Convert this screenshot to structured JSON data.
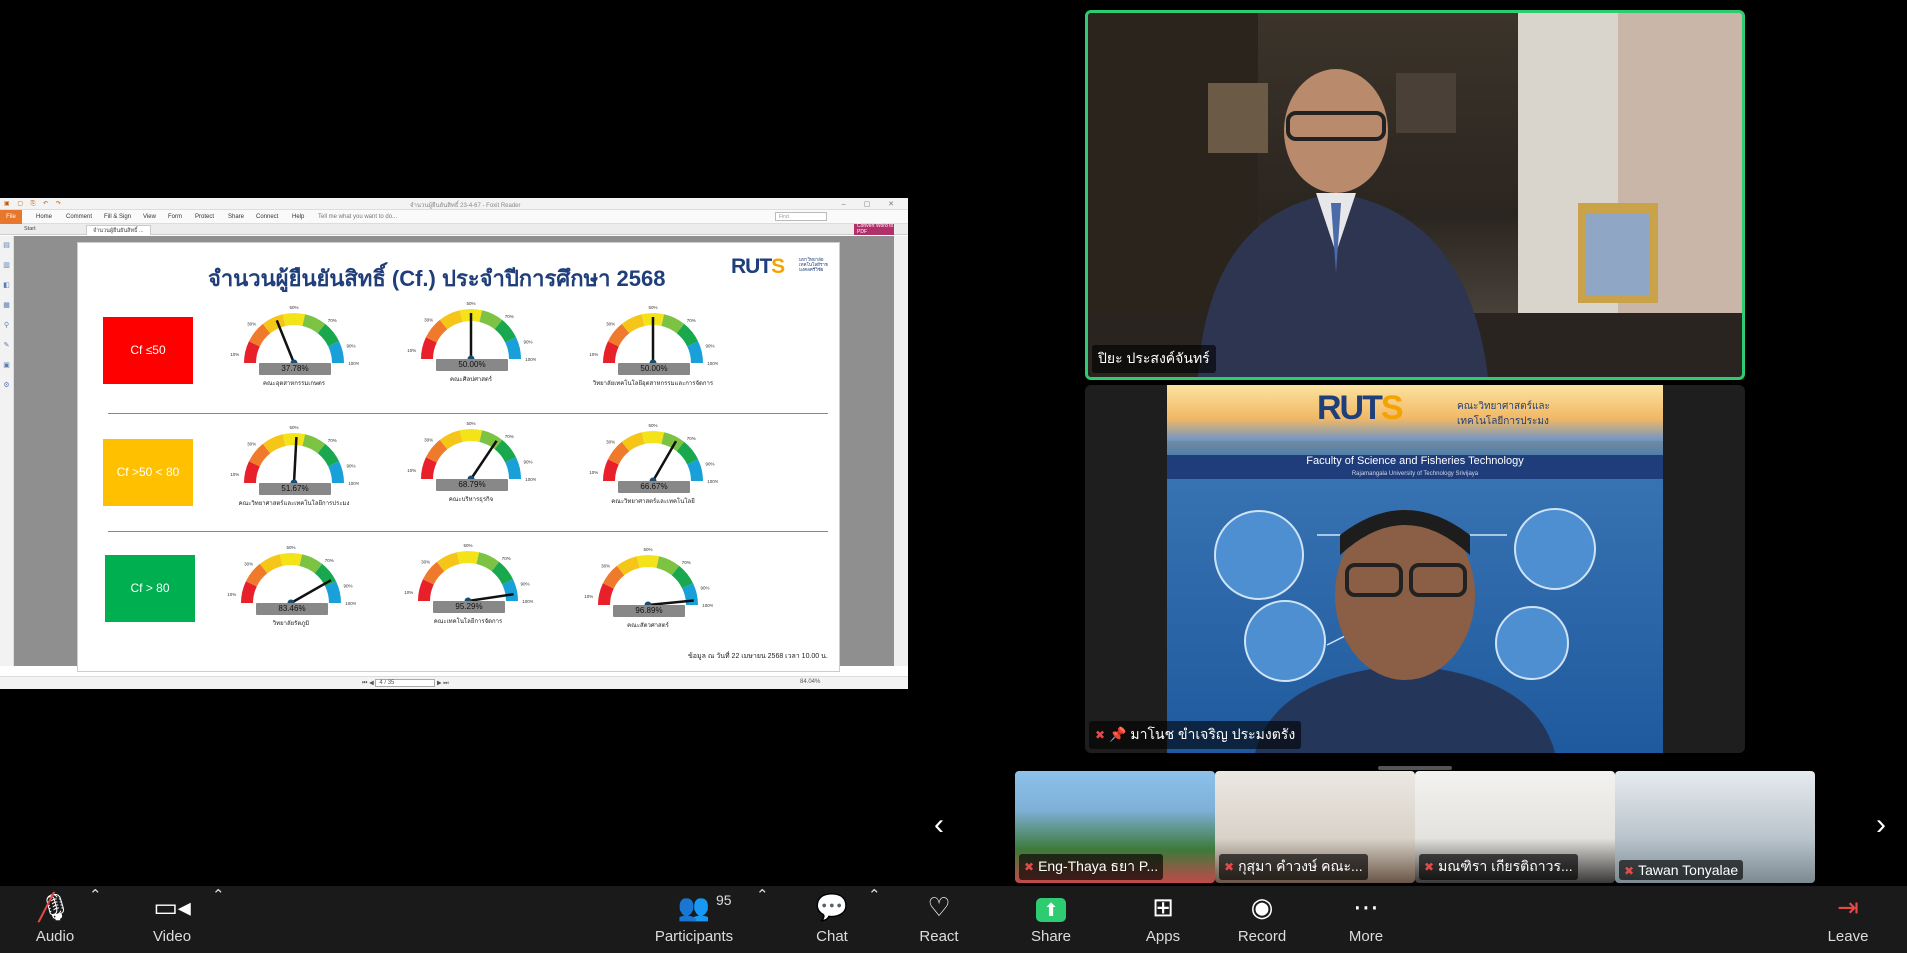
{
  "shared_screen": {
    "window_title": "จำนวนผู้ยืนยันสิทธิ์ 23-4-67 - Foxit Reader",
    "ribbon_file": "File",
    "ribbon_menu": [
      "Home",
      "Comment",
      "Fill & Sign",
      "View",
      "Form",
      "Protect",
      "Share",
      "Connect",
      "Help"
    ],
    "tell_me": "Tell me what you want to do...",
    "search_placeholder": "Find",
    "tabs": [
      "Start",
      "จำนวนผู้ยืนยันสิทธิ์ ..."
    ],
    "convert_label": "Convert Word to PDF",
    "page_indicator": "4 / 35",
    "zoom": "84.04%",
    "slide": {
      "title": "จำนวนผู้ยืนยันสิทธิ์ (Cf.) ประจำปีการศึกษา 2568",
      "logo_text": "RUTS",
      "logo_sub": "มหาวิทยาลัยเทคโนโลยีราชมงคลศรีวิชัย",
      "categories": [
        {
          "label": "Cf ≤50",
          "color": "#ff0000"
        },
        {
          "label": "Cf >50 < 80",
          "color": "#ffc000"
        },
        {
          "label": "Cf > 80",
          "color": "#00b050"
        }
      ],
      "gauge_ticks": [
        "10%",
        "30%",
        "50%",
        "70%",
        "90%",
        "100%"
      ],
      "gauges": [
        {
          "value": "37.78%",
          "fraction": 0.3778,
          "label": "คณะอุตสาหกรรมเกษตร"
        },
        {
          "value": "50.00%",
          "fraction": 0.5,
          "label": "คณะศิลปศาสตร์"
        },
        {
          "value": "50.00%",
          "fraction": 0.5,
          "label": "วิทยาลัยเทคโนโลยีอุตสาหกรรมและการจัดการ"
        },
        {
          "value": "51.67%",
          "fraction": 0.5167,
          "label": "คณะวิทยาศาสตร์และเทคโนโลยีการประมง"
        },
        {
          "value": "68.79%",
          "fraction": 0.6879,
          "label": "คณะบริหารธุรกิจ"
        },
        {
          "value": "66.67%",
          "fraction": 0.6667,
          "label": "คณะวิทยาศาสตร์และเทคโนโลยี"
        },
        {
          "value": "83.46%",
          "fraction": 0.8346,
          "label": "วิทยาลัยรัตภูมิ"
        },
        {
          "value": "95.29%",
          "fraction": 0.9529,
          "label": "คณะเทคโนโลยีการจัดการ"
        },
        {
          "value": "96.89%",
          "fraction": 0.9689,
          "label": "คณะสัตวศาสตร์"
        }
      ],
      "note": "ข้อมูล ณ วันที่ 22 เมษายน 2568 เวลา 10.00 น."
    }
  },
  "active_speaker": {
    "name": "ปิยะ ประสงค์จันทร์"
  },
  "second_speaker": {
    "name": "มาโนช ขำเจริญ ประมงตรัง",
    "bg_logo": "RUTS",
    "bg_faculty_th": "คณะวิทยาศาสตร์และเทคโนโลยีการประมง",
    "bg_faculty_en": "Faculty of Science and Fisheries Technology",
    "bg_university_en": "Rajamangala University of Technology Srivijaya"
  },
  "thumbnails": [
    {
      "name": "Eng-Thaya ธยา P..."
    },
    {
      "name": "กุสุมา คำวงษ์ คณะ..."
    },
    {
      "name": "มณฑิรา เกียรติถาวร..."
    },
    {
      "name": "Tawan Tonyalae"
    }
  ],
  "toolbar": {
    "audio": "Audio",
    "video": "Video",
    "participants": "Participants",
    "participants_count": "95",
    "chat": "Chat",
    "react": "React",
    "share": "Share",
    "apps": "Apps",
    "record": "Record",
    "more": "More",
    "leave": "Leave"
  }
}
